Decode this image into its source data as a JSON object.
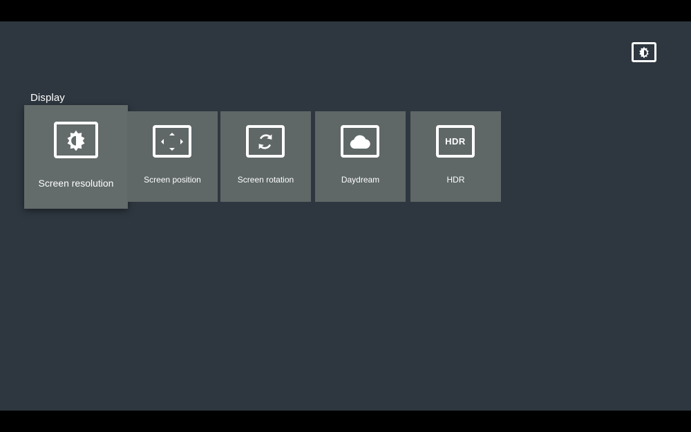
{
  "section": {
    "title": "Display"
  },
  "header": {
    "icon": "brightness-icon"
  },
  "cards": [
    {
      "label": "Screen resolution",
      "icon": "brightness-icon",
      "focused": true
    },
    {
      "label": "Screen position",
      "icon": "screen-position-icon",
      "focused": false
    },
    {
      "label": "Screen rotation",
      "icon": "rotation-icon",
      "focused": false
    },
    {
      "label": "Daydream",
      "icon": "cloud-icon",
      "focused": false
    },
    {
      "label": "HDR",
      "icon": "hdr-icon",
      "focused": false
    }
  ],
  "hdr_icon_text": "HDR",
  "colors": {
    "background": "#2e3740",
    "card": "#5f6767",
    "text": "#ffffff"
  }
}
